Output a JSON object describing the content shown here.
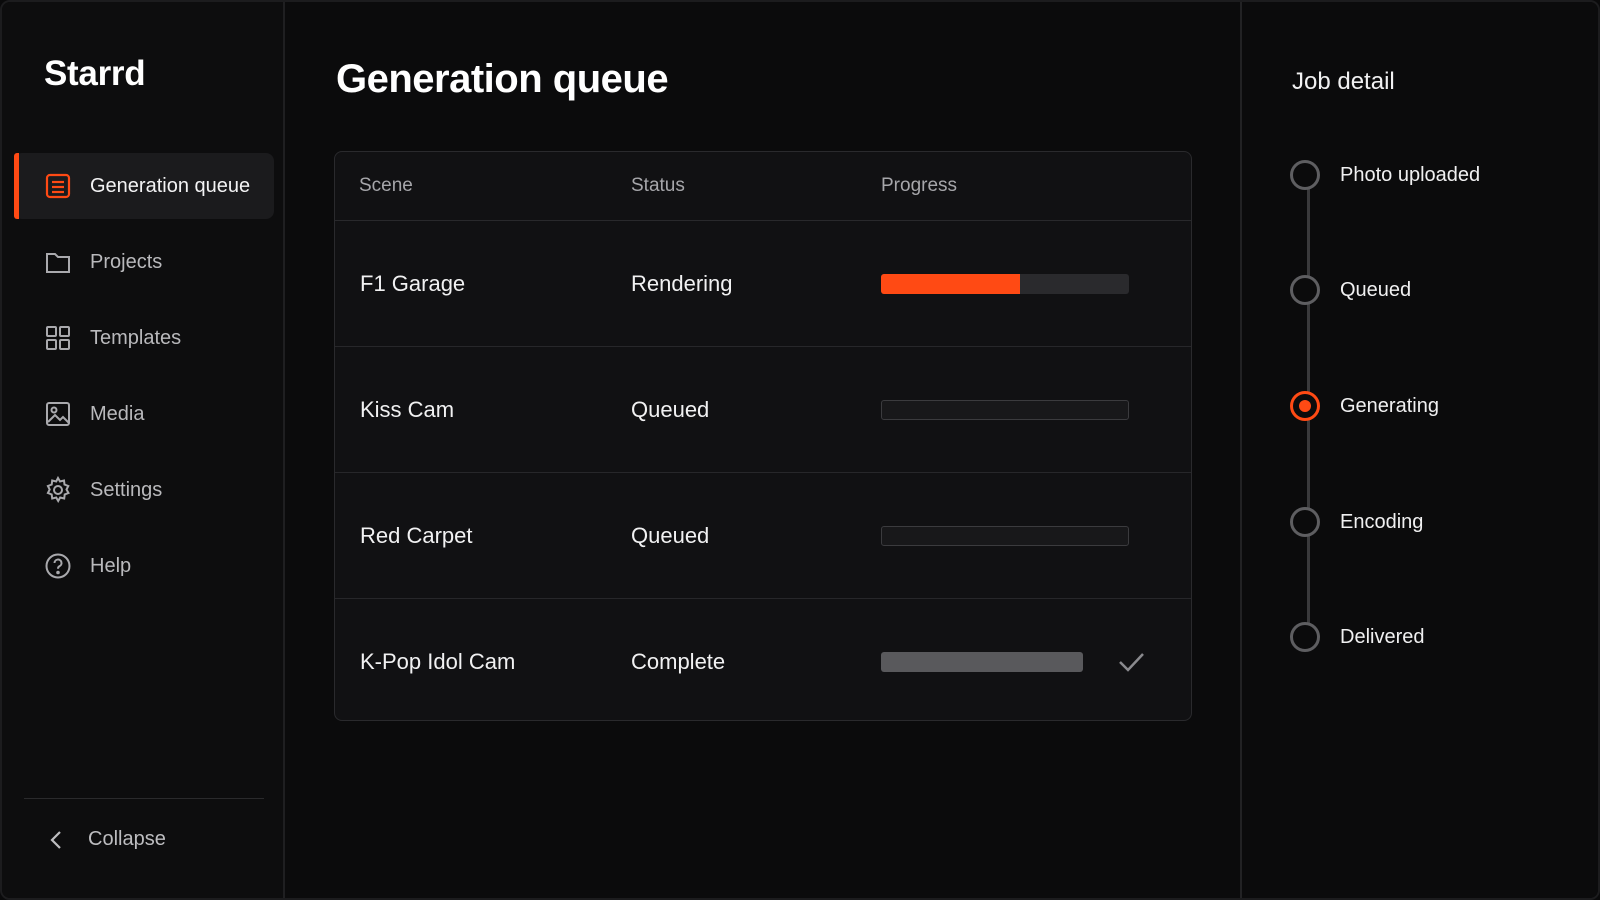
{
  "app": {
    "brand": "Starrd"
  },
  "sidebar": {
    "items": [
      {
        "label": "Generation queue",
        "icon": "list-icon",
        "active": true
      },
      {
        "label": "Projects",
        "icon": "folder-icon",
        "active": false
      },
      {
        "label": "Templates",
        "icon": "grid-icon",
        "active": false
      },
      {
        "label": "Media",
        "icon": "image-icon",
        "active": false
      },
      {
        "label": "Settings",
        "icon": "gear-icon",
        "active": false
      },
      {
        "label": "Help",
        "icon": "help-icon",
        "active": false
      }
    ],
    "collapse_label": "Collapse"
  },
  "main": {
    "title": "Generation queue",
    "columns": {
      "scene": "Scene",
      "status": "Status",
      "progress": "Progress"
    },
    "rows": [
      {
        "scene": "F1 Garage",
        "status": "Rendering",
        "progress": 0.56,
        "state": "rendering"
      },
      {
        "scene": "Kiss Cam",
        "status": "Queued",
        "progress": 0,
        "state": "queued"
      },
      {
        "scene": "Red Carpet",
        "status": "Queued",
        "progress": 0,
        "state": "queued"
      },
      {
        "scene": "K-Pop Idol Cam",
        "status": "Complete",
        "progress": 1,
        "state": "complete"
      }
    ]
  },
  "detail": {
    "title": "Job detail",
    "steps": [
      {
        "label": "Photo uploaded",
        "active": false
      },
      {
        "label": "Queued",
        "active": false
      },
      {
        "label": "Generating",
        "active": true
      },
      {
        "label": "Encoding",
        "active": false
      },
      {
        "label": "Delivered",
        "active": false
      }
    ]
  },
  "colors": {
    "accent": "#ff4a14",
    "background": "#0b0b0c",
    "panel": "#111113"
  }
}
